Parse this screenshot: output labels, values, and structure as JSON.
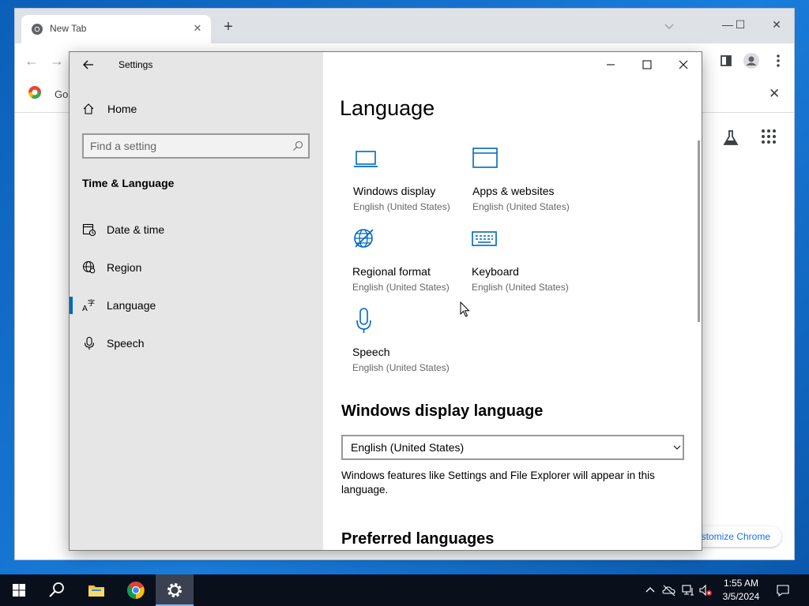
{
  "chrome": {
    "tab_title": "New Tab",
    "bookmark_label": "Go",
    "customize_label": "Customize Chrome"
  },
  "settings": {
    "window_title": "Settings",
    "home_label": "Home",
    "search_placeholder": "Find a setting",
    "section_title": "Time & Language",
    "nav_items": [
      {
        "label": "Date & time",
        "icon": "calendar-clock-icon"
      },
      {
        "label": "Region",
        "icon": "globe-region-icon"
      },
      {
        "label": "Language",
        "icon": "language-icon",
        "active": true
      },
      {
        "label": "Speech",
        "icon": "microphone-icon"
      }
    ],
    "page_title": "Language",
    "tiles": [
      {
        "label": "Windows display",
        "sub": "English (United States)",
        "icon": "laptop-icon"
      },
      {
        "label": "Apps & websites",
        "sub": "English (United States)",
        "icon": "window-icon"
      },
      {
        "label": "Regional format",
        "sub": "English (United States)",
        "icon": "globe-format-icon"
      },
      {
        "label": "Keyboard",
        "sub": "English (United States)",
        "icon": "keyboard-icon"
      },
      {
        "label": "Speech",
        "sub": "English (United States)",
        "icon": "microphone-icon"
      }
    ],
    "display_language_heading": "Windows display language",
    "display_language_value": "English (United States)",
    "display_language_desc": "Windows features like Settings and File Explorer will appear in this language.",
    "preferred_heading": "Preferred languages"
  },
  "taskbar": {
    "time": "1:55 AM",
    "date": "3/5/2024"
  },
  "colors": {
    "accent": "#0067c0",
    "sidebar_bg": "#e6e6e6",
    "taskbar_bg": "#0a0f1c"
  }
}
